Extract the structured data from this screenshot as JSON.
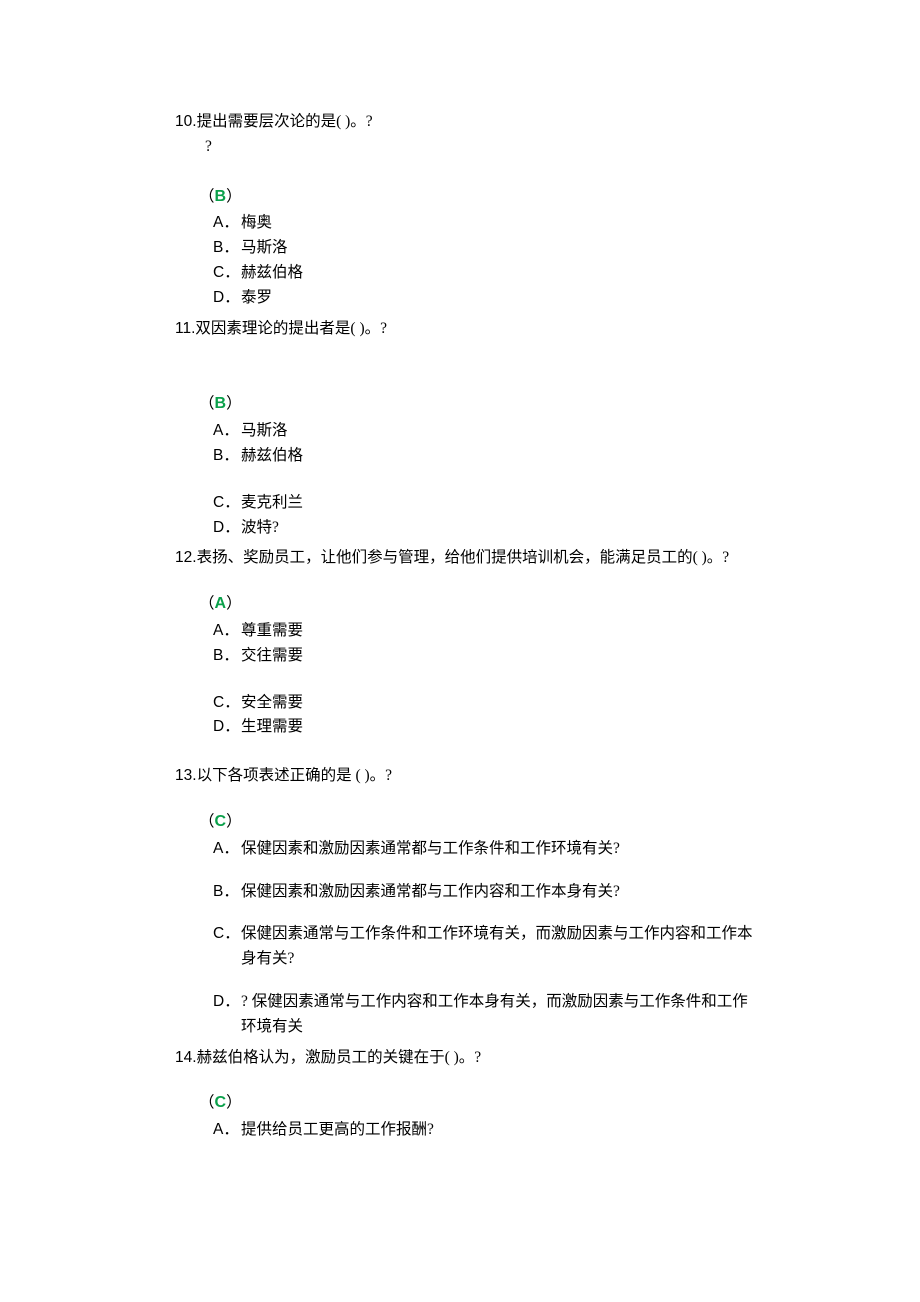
{
  "questions": [
    {
      "num": "10.",
      "text": "提出需要层次论的是(  )。?",
      "sub": "?",
      "answer": "B",
      "options": [
        {
          "letter": "A．",
          "text": "梅奥"
        },
        {
          "letter": "B．",
          "text": "马斯洛"
        },
        {
          "letter": "C．",
          "text": "赫兹伯格"
        },
        {
          "letter": "D．",
          "text": " 泰罗"
        }
      ]
    },
    {
      "num": "11.",
      "text": "双因素理论的提出者是(  )。?",
      "answer": "B",
      "options": [
        {
          "letter": "A．",
          "text": "马斯洛"
        },
        {
          "letter": "B．",
          "text": " 赫兹伯格"
        },
        {
          "letter": "C．",
          "text": "麦克利兰"
        },
        {
          "letter": "D．",
          "text": " 波特?"
        }
      ]
    },
    {
      "num": "12.",
      "text": "表扬、奖励员工，让他们参与管理，给他们提供培训机会，能满足员工的(  )。?",
      "answer": "A",
      "options": [
        {
          "letter": "A．",
          "text": " 尊重需要"
        },
        {
          "letter": "B．",
          "text": " 交往需要"
        },
        {
          "letter": "C．",
          "text": "安全需要"
        },
        {
          "letter": "D．",
          "text": " 生理需要"
        }
      ]
    },
    {
      "num": "13.",
      "text": "以下各项表述正确的是 (  )。?",
      "answer": "C",
      "options": [
        {
          "letter": "A．",
          "text": " 保健因素和激励因素通常都与工作条件和工作环境有关?"
        },
        {
          "letter": "B．",
          "text": " 保健因素和激励因素通常都与工作内容和工作本身有关?"
        },
        {
          "letter": "C．",
          "text": "保健因素通常与工作条件和工作环境有关，而激励因素与工作内容和工作本身有关?"
        },
        {
          "letter": "D．",
          "text": "? 保健因素通常与工作内容和工作本身有关，而激励因素与工作条件和工作环境有关"
        }
      ]
    },
    {
      "num": "14.",
      "text": "赫兹伯格认为，激励员工的关键在于(  )。?",
      "answer": "C",
      "options": [
        {
          "letter": "A．",
          "text": " 提供给员工更高的工作报酬?"
        }
      ]
    }
  ]
}
